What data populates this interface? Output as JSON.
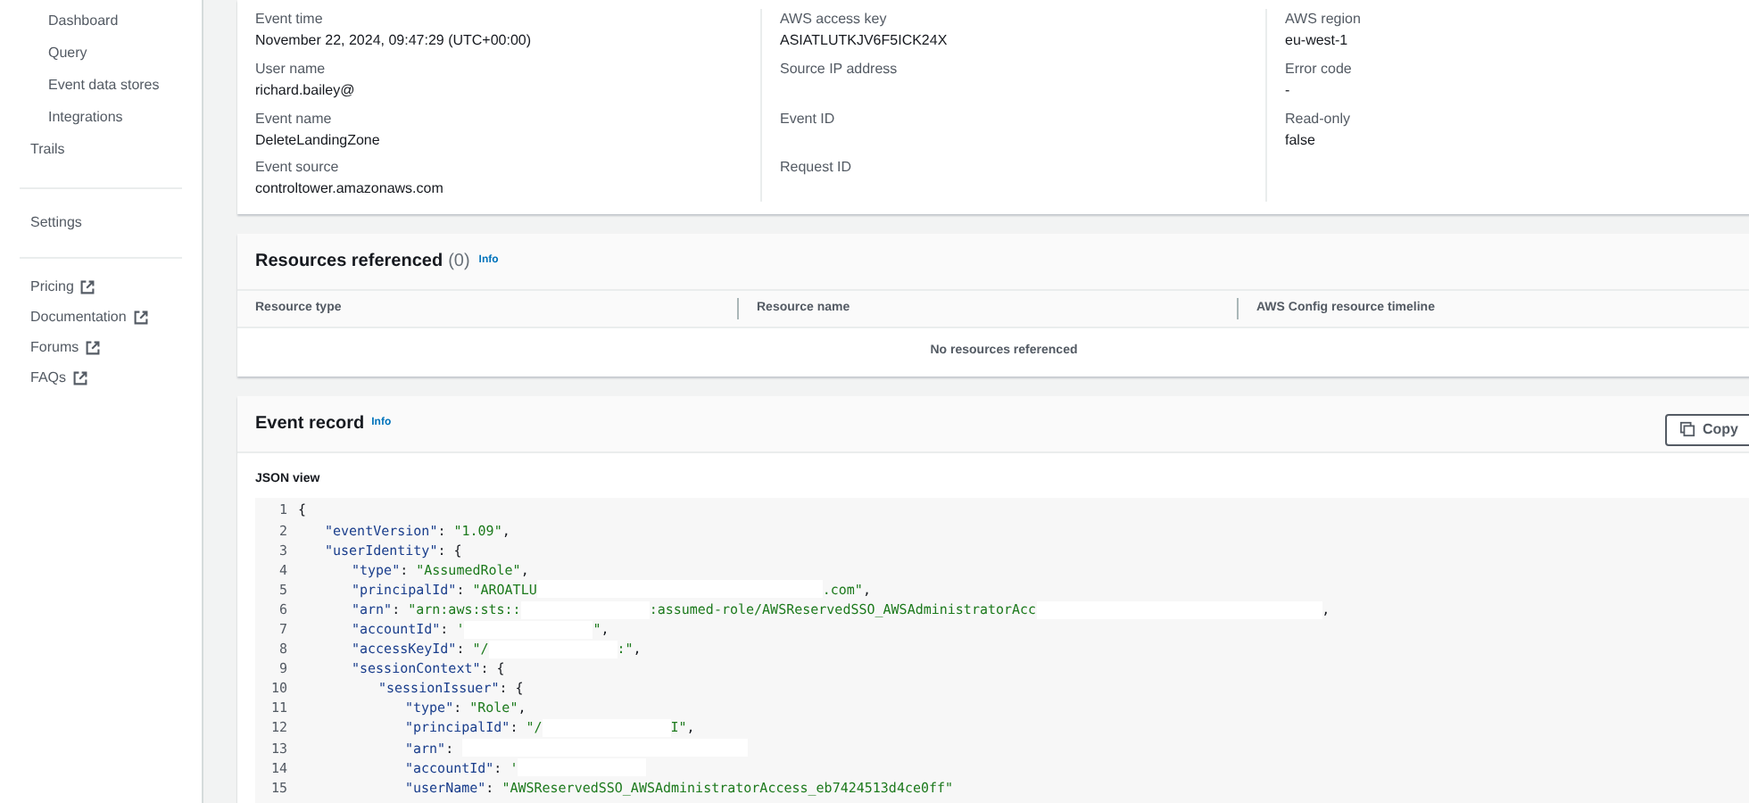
{
  "sidebar": {
    "sub_items": [
      "Dashboard",
      "Query",
      "Event data stores",
      "Integrations"
    ],
    "items": [
      "Trails"
    ],
    "settings": "Settings",
    "links": [
      "Pricing",
      "Documentation",
      "Forums",
      "FAQs"
    ]
  },
  "details": {
    "columns": [
      [
        {
          "label": "Event time",
          "value": "November 22, 2024, 09:47:29 (UTC+00:00)"
        },
        {
          "label": "User name",
          "value": "richard.bailey@"
        },
        {
          "label": "Event name",
          "value": "DeleteLandingZone"
        },
        {
          "label": "Event source",
          "value": "controltower.amazonaws.com"
        }
      ],
      [
        {
          "label": "AWS access key",
          "value": "ASIATLUTKJV6F5ICK24X"
        },
        {
          "label": "Source IP address"
        },
        {
          "label": "Event ID"
        },
        {
          "label": "Request ID"
        }
      ],
      [
        {
          "label": "AWS region",
          "value": "eu-west-1"
        },
        {
          "label": "Error code",
          "value": "-"
        },
        {
          "label": "Read-only",
          "value": "false"
        }
      ]
    ]
  },
  "resources": {
    "title": "Resources referenced",
    "count": "(0)",
    "info": "Info",
    "columns": [
      "Resource type",
      "Resource name",
      "AWS Config resource timeline"
    ],
    "empty": "No resources referenced"
  },
  "event_record": {
    "title": "Event record",
    "info": "Info",
    "copy": "Copy",
    "view_label": "JSON view",
    "lines": [
      {
        "number": "1",
        "parts": [
          {
            "kind": "punct",
            "text": "{"
          }
        ],
        "children": [
          {
            "number": "2",
            "parts": [
              {
                "kind": "key",
                "text": "\"eventVersion\""
              },
              {
                "kind": "punct",
                "text": ": "
              },
              {
                "kind": "string",
                "text": "\"1.09\""
              },
              {
                "kind": "punct",
                "text": ","
              }
            ]
          },
          {
            "number": "3",
            "parts": [
              {
                "kind": "key",
                "text": "\"userIdentity\""
              },
              {
                "kind": "punct",
                "text": ": {"
              }
            ],
            "children": [
              {
                "number": "4",
                "parts": [
                  {
                    "kind": "key",
                    "text": "\"type\""
                  },
                  {
                    "kind": "punct",
                    "text": ": "
                  },
                  {
                    "kind": "string",
                    "text": "\"AssumedRole\""
                  },
                  {
                    "kind": "punct",
                    "text": ","
                  }
                ]
              },
              {
                "number": "5",
                "parts": [
                  {
                    "kind": "key",
                    "text": "\"principalId\""
                  },
                  {
                    "kind": "punct",
                    "text": ": "
                  },
                  {
                    "kind": "string",
                    "text": "\"AROATLU"
                  },
                  {
                    "kind": "redacted_long"
                  },
                  {
                    "kind": "string",
                    "text": ".com\""
                  },
                  {
                    "kind": "punct",
                    "text": ","
                  }
                ]
              },
              {
                "number": "6",
                "parts": [
                  {
                    "kind": "key",
                    "text": "\"arn\""
                  },
                  {
                    "kind": "punct",
                    "text": ": "
                  },
                  {
                    "kind": "string",
                    "text": "\"arn:aws:sts::"
                  },
                  {
                    "kind": "redacted"
                  },
                  {
                    "kind": "string",
                    "text": ":assumed-role/AWSReservedSSO_AWSAdministratorAcc"
                  },
                  {
                    "kind": "redacted_long"
                  },
                  {
                    "kind": "punct",
                    "text": ","
                  }
                ]
              },
              {
                "number": "7",
                "parts": [
                  {
                    "kind": "key",
                    "text": "\"accountId\""
                  },
                  {
                    "kind": "punct",
                    "text": ": "
                  },
                  {
                    "kind": "string",
                    "text": "'"
                  },
                  {
                    "kind": "redacted"
                  },
                  {
                    "kind": "string",
                    "text": "\""
                  },
                  {
                    "kind": "punct",
                    "text": ","
                  }
                ]
              },
              {
                "number": "8",
                "parts": [
                  {
                    "kind": "key",
                    "text": "\"accessKeyId\""
                  },
                  {
                    "kind": "punct",
                    "text": ": "
                  },
                  {
                    "kind": "string",
                    "text": "\"/"
                  },
                  {
                    "kind": "redacted"
                  },
                  {
                    "kind": "string",
                    "text": ":\""
                  },
                  {
                    "kind": "punct",
                    "text": ","
                  }
                ]
              },
              {
                "number": "9",
                "parts": [
                  {
                    "kind": "key",
                    "text": "\"sessionContext\""
                  },
                  {
                    "kind": "punct",
                    "text": ": {"
                  }
                ],
                "children": [
                  {
                    "number": "10",
                    "parts": [
                      {
                        "kind": "key",
                        "text": "\"sessionIssuer\""
                      },
                      {
                        "kind": "punct",
                        "text": ": {"
                      }
                    ],
                    "children": [
                      {
                        "number": "11",
                        "parts": [
                          {
                            "kind": "key",
                            "text": "\"type\""
                          },
                          {
                            "kind": "punct",
                            "text": ": "
                          },
                          {
                            "kind": "string",
                            "text": "\"Role\""
                          },
                          {
                            "kind": "punct",
                            "text": ","
                          }
                        ]
                      },
                      {
                        "number": "12",
                        "parts": [
                          {
                            "kind": "key",
                            "text": "\"principalId\""
                          },
                          {
                            "kind": "punct",
                            "text": ": "
                          },
                          {
                            "kind": "string",
                            "text": "\"/"
                          },
                          {
                            "kind": "redacted"
                          },
                          {
                            "kind": "string",
                            "text": "I\""
                          },
                          {
                            "kind": "punct",
                            "text": ","
                          }
                        ]
                      },
                      {
                        "number": "13",
                        "parts": [
                          {
                            "kind": "key",
                            "text": "\"arn\""
                          },
                          {
                            "kind": "punct",
                            "text": ": "
                          },
                          {
                            "kind": "redacted_long"
                          }
                        ]
                      },
                      {
                        "number": "14",
                        "parts": [
                          {
                            "kind": "key",
                            "text": "\"accountId\""
                          },
                          {
                            "kind": "punct",
                            "text": ": "
                          },
                          {
                            "kind": "string",
                            "text": "'"
                          },
                          {
                            "kind": "redacted"
                          }
                        ]
                      },
                      {
                        "number": "15",
                        "parts": [
                          {
                            "kind": "key",
                            "text": "\"userName\""
                          },
                          {
                            "kind": "punct",
                            "text": ": "
                          },
                          {
                            "kind": "string",
                            "text": "\"AWSReservedSSO_AWSAdministratorAccess_eb7424513d4ce0ff\""
                          }
                        ]
                      }
                    ]
                  }
                ]
              }
            ]
          }
        ]
      }
    ]
  }
}
